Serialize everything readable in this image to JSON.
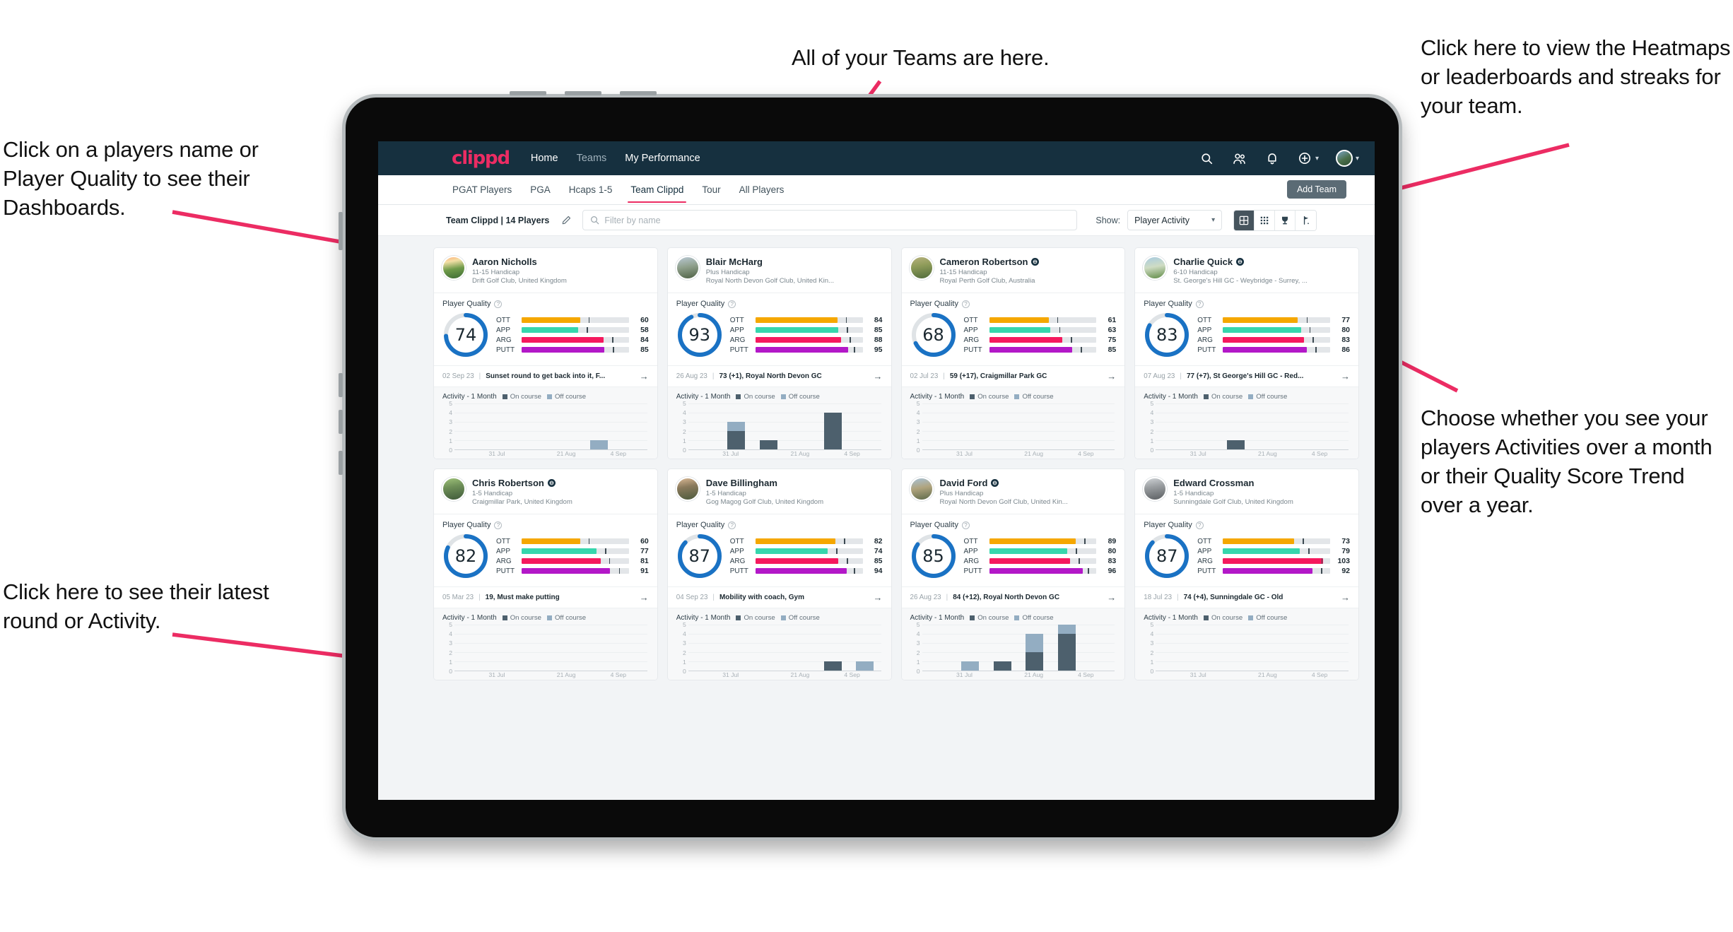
{
  "annotations": {
    "teams": "All of your Teams are here.",
    "heatmap": "Click here to view the Heatmaps or leaderboards and streaks for your team.",
    "players": "Click on a players name or Player Quality to see their Dashboards.",
    "choose": "Choose whether you see your players Activities over a month or their Quality Score Trend over a year.",
    "latest": "Click here to see their latest round or Activity."
  },
  "topnav": {
    "brand": "clippd",
    "links": [
      {
        "label": "Home",
        "active": true
      },
      {
        "label": "Teams",
        "active": false
      },
      {
        "label": "My Performance",
        "active": true
      }
    ],
    "icons": [
      "search-icon",
      "people-icon",
      "bell-icon",
      "plus-circle-icon",
      "avatar"
    ]
  },
  "tabs": {
    "items": [
      "PGAT Players",
      "PGA",
      "Hcaps 1-5",
      "Team Clippd",
      "Tour",
      "All Players"
    ],
    "active": "Team Clippd",
    "add_team_label": "Add Team"
  },
  "filterbar": {
    "team_label": "Team Clippd | 14 Players",
    "edit_icon": "pencil-icon",
    "search_placeholder": "Filter by name",
    "search_value": "",
    "show_label": "Show:",
    "show_value": "Player Activity",
    "view_toggles": [
      {
        "name": "grid-view-icon",
        "active": true
      },
      {
        "name": "heatmap-view-icon",
        "active": false
      },
      {
        "name": "leaderboard-trophy-icon",
        "active": false
      },
      {
        "name": "streaks-flag-icon",
        "active": false
      }
    ]
  },
  "card_labels": {
    "quality_title": "Player Quality",
    "activity_title": "Activity - 1 Month",
    "legend_on": "On course",
    "legend_off": "Off course",
    "metrics": [
      "OTT",
      "APP",
      "ARG",
      "PUTT"
    ],
    "x_labels": [
      "31 Jul",
      "21 Aug",
      "4 Sep"
    ],
    "y_labels": [
      "5",
      "4",
      "3",
      "2",
      "1",
      "0"
    ]
  },
  "colors": {
    "brand": "#ec2c63",
    "nav_bg": "#16303f",
    "ring": "#1a72c4",
    "ott": "#f5a700",
    "app": "#36d6ac",
    "arg": "#f5195e",
    "putt": "#b318c8",
    "on_course": "#4d606d",
    "off_course": "#93adc2"
  },
  "players": [
    {
      "name": "Aaron Nicholls",
      "verified": false,
      "handicap": "11-15 Handicap",
      "club": "Drift Golf Club, United Kingdom",
      "quality": 74,
      "metrics": {
        "OTT": 60,
        "APP": 58,
        "ARG": 84,
        "PUTT": 85
      },
      "round_date": "02 Sep 23",
      "round_text": "Sunset round to get back into it, F...",
      "avatar_css": "linear-gradient(170deg,#ffb07a 0%,#f3e0a6 22%,#6f9b4a 55%,#3d6b34 100%)",
      "activity": [
        {
          "on": 0,
          "off": 0
        },
        {
          "on": 0,
          "off": 0
        },
        {
          "on": 0,
          "off": 0
        },
        {
          "on": 0,
          "off": 0
        },
        {
          "on": 0,
          "off": 1
        },
        {
          "on": 0,
          "off": 0
        }
      ]
    },
    {
      "name": "Blair McHarg",
      "verified": false,
      "handicap": "Plus Handicap",
      "club": "Royal North Devon Golf Club, United Kin...",
      "quality": 93,
      "metrics": {
        "OTT": 84,
        "APP": 85,
        "ARG": 88,
        "PUTT": 95
      },
      "round_date": "26 Aug 23",
      "round_text": "73 (+1), Royal North Devon GC",
      "avatar_css": "linear-gradient(170deg,#b9c8d4 0%,#8fa08c 45%,#4e6144 100%)",
      "activity": [
        {
          "on": 0,
          "off": 0
        },
        {
          "on": 2,
          "off": 1
        },
        {
          "on": 1,
          "off": 0
        },
        {
          "on": 0,
          "off": 0
        },
        {
          "on": 4,
          "off": 0
        },
        {
          "on": 0,
          "off": 0
        }
      ]
    },
    {
      "name": "Cameron Robertson",
      "verified": true,
      "handicap": "11-15 Handicap",
      "club": "Royal Perth Golf Club, Australia",
      "quality": 68,
      "metrics": {
        "OTT": 61,
        "APP": 63,
        "ARG": 75,
        "PUTT": 85
      },
      "round_date": "02 Jul 23",
      "round_text": "59 (+17), Craigmillar Park GC",
      "avatar_css": "linear-gradient(170deg,#b7b27e 0%,#8f9c5a 40%,#4f6b3a 100%)",
      "activity": [
        {
          "on": 0,
          "off": 0
        },
        {
          "on": 0,
          "off": 0
        },
        {
          "on": 0,
          "off": 0
        },
        {
          "on": 0,
          "off": 0
        },
        {
          "on": 0,
          "off": 0
        },
        {
          "on": 0,
          "off": 0
        }
      ]
    },
    {
      "name": "Charlie Quick",
      "verified": true,
      "handicap": "6-10 Handicap",
      "club": "St. George's Hill GC - Weybridge - Surrey, ...",
      "quality": 83,
      "metrics": {
        "OTT": 77,
        "APP": 80,
        "ARG": 83,
        "PUTT": 86
      },
      "round_date": "07 Aug 23",
      "round_text": "77 (+7), St George's Hill GC - Red...",
      "avatar_css": "linear-gradient(170deg,#a8cbe0 0%,#cfdcc4 45%,#5f8b45 100%)",
      "activity": [
        {
          "on": 0,
          "off": 0
        },
        {
          "on": 0,
          "off": 0
        },
        {
          "on": 1,
          "off": 0
        },
        {
          "on": 0,
          "off": 0
        },
        {
          "on": 0,
          "off": 0
        },
        {
          "on": 0,
          "off": 0
        }
      ]
    },
    {
      "name": "Chris Robertson",
      "verified": true,
      "handicap": "1-5 Handicap",
      "club": "Craigmillar Park, United Kingdom",
      "quality": 82,
      "metrics": {
        "OTT": 60,
        "APP": 77,
        "ARG": 81,
        "PUTT": 91
      },
      "round_date": "05 Mar 23",
      "round_text": "19, Must make putting",
      "avatar_css": "linear-gradient(170deg,#9fc27a 0%,#6e8f58 40%,#3f5a3a 100%)",
      "activity": [
        {
          "on": 0,
          "off": 0
        },
        {
          "on": 0,
          "off": 0
        },
        {
          "on": 0,
          "off": 0
        },
        {
          "on": 0,
          "off": 0
        },
        {
          "on": 0,
          "off": 0
        },
        {
          "on": 0,
          "off": 0
        }
      ]
    },
    {
      "name": "Dave Billingham",
      "verified": false,
      "handicap": "1-5 Handicap",
      "club": "Gog Magog Golf Club, United Kingdom",
      "quality": 87,
      "metrics": {
        "OTT": 82,
        "APP": 74,
        "ARG": 85,
        "PUTT": 94
      },
      "round_date": "04 Sep 23",
      "round_text": "Mobility with coach, Gym",
      "avatar_css": "linear-gradient(170deg,#d9b894 0%,#8a7a5c 40%,#4c5a3c 100%)",
      "activity": [
        {
          "on": 0,
          "off": 0
        },
        {
          "on": 0,
          "off": 0
        },
        {
          "on": 0,
          "off": 0
        },
        {
          "on": 0,
          "off": 0
        },
        {
          "on": 1,
          "off": 0
        },
        {
          "on": 0,
          "off": 1
        }
      ]
    },
    {
      "name": "David Ford",
      "verified": true,
      "handicap": "Plus Handicap",
      "club": "Royal North Devon Golf Club, United Kin...",
      "quality": 85,
      "metrics": {
        "OTT": 89,
        "APP": 80,
        "ARG": 83,
        "PUTT": 96
      },
      "round_date": "26 Aug 23",
      "round_text": "84 (+12), Royal North Devon GC",
      "avatar_css": "linear-gradient(170deg,#a8c2d6 0%,#b0a47e 45%,#5e6a4a 100%)",
      "activity": [
        {
          "on": 0,
          "off": 0
        },
        {
          "on": 0,
          "off": 1
        },
        {
          "on": 1,
          "off": 0
        },
        {
          "on": 2,
          "off": 2
        },
        {
          "on": 4,
          "off": 1
        },
        {
          "on": 0,
          "off": 0
        }
      ]
    },
    {
      "name": "Edward Crossman",
      "verified": false,
      "handicap": "1-5 Handicap",
      "club": "Sunningdale Golf Club, United Kingdom",
      "quality": 87,
      "metrics": {
        "OTT": 73,
        "APP": 79,
        "ARG": 103,
        "PUTT": 92
      },
      "round_date": "18 Jul 23",
      "round_text": "74 (+4), Sunningdale GC - Old",
      "avatar_css": "linear-gradient(170deg,#cfd3d6 0%,#9a9ea1 40%,#5b5f62 100%)",
      "activity": [
        {
          "on": 0,
          "off": 0
        },
        {
          "on": 0,
          "off": 0
        },
        {
          "on": 0,
          "off": 0
        },
        {
          "on": 0,
          "off": 0
        },
        {
          "on": 0,
          "off": 0
        },
        {
          "on": 0,
          "off": 0
        }
      ]
    }
  ]
}
